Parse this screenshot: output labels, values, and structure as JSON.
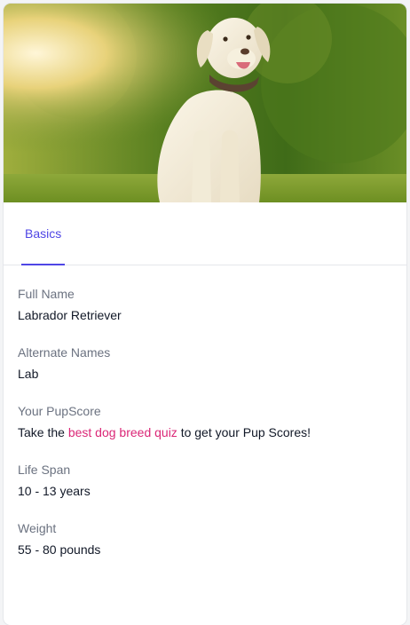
{
  "hero": {
    "image_alt": "Labrador Retriever sitting on grass"
  },
  "tabs": [
    {
      "label": "Basics",
      "active": true
    }
  ],
  "fields": {
    "full_name": {
      "label": "Full Name",
      "value": "Labrador Retriever"
    },
    "alternate_names": {
      "label": "Alternate Names",
      "value": "Lab"
    },
    "pupscore": {
      "label": "Your PupScore",
      "prefix": "Take the ",
      "link_text": "best dog breed quiz",
      "suffix": " to get your Pup Scores!"
    },
    "life_span": {
      "label": "Life Span",
      "value": "10 - 13 years"
    },
    "weight": {
      "label": "Weight",
      "value": "55 - 80 pounds"
    }
  },
  "colors": {
    "accent": "#4f46e5",
    "link": "#db2777",
    "muted_text": "#6b7280",
    "text": "#111827"
  }
}
